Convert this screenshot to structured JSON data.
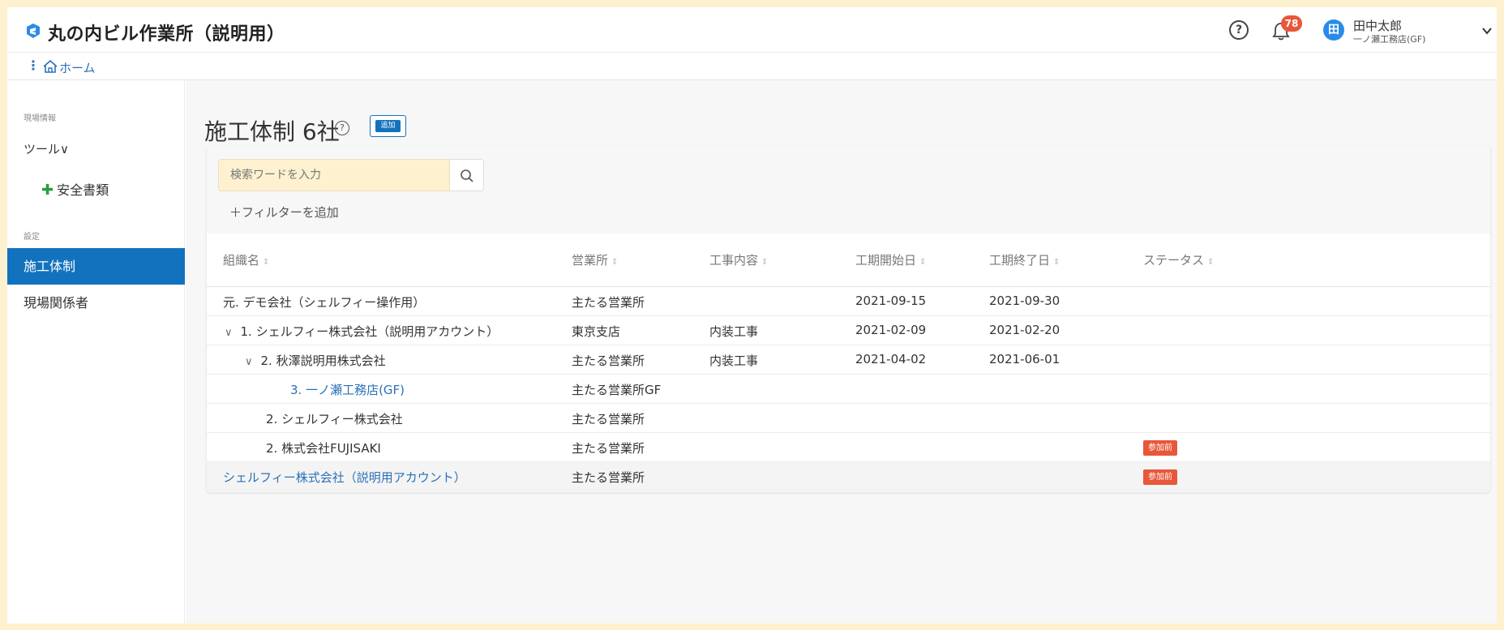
{
  "header": {
    "site_title": "丸の内ビル作業所（説明用）",
    "help_symbol": "?",
    "notification_count": "78",
    "user_avatar_initial": "田",
    "user_name": "田中太郎",
    "user_org": "一ノ瀬工務店(GF)"
  },
  "breadcrumb": {
    "menu_symbol": "⋮",
    "home_label": "ホーム"
  },
  "sidebar": {
    "section_site_info": "現場情報",
    "tool_label": "ツール∨",
    "safety_docs_label": "安全書類",
    "section_settings": "設定",
    "items": [
      {
        "label": "施工体制",
        "active": true
      },
      {
        "label": "現場関係者",
        "active": false
      }
    ]
  },
  "main": {
    "page_title": "施工体制 6社",
    "title_help_symbol": "?",
    "add_button_label": "追加",
    "search_placeholder": "検索ワードを入力",
    "add_filter_label": "＋フィルターを追加"
  },
  "table": {
    "headers": [
      "組織名",
      "営業所",
      "工事内容",
      "工期開始日",
      "工期終了日",
      "ステータス"
    ],
    "sort_symbol": "⇕",
    "rows": [
      {
        "org": "元. デモ会社（シェルフィー操作用）",
        "office": "主たる営業所",
        "work": "",
        "start": "2021-09-15",
        "end": "2021-09-30",
        "status": "",
        "chevron": ""
      },
      {
        "org": "1. シェルフィー株式会社（説明用アカウント）",
        "office": "東京支店",
        "work": "内装工事",
        "start": "2021-02-09",
        "end": "2021-02-20",
        "status": "",
        "chevron": "∨"
      },
      {
        "org": "2. 秋澤説明用株式会社",
        "office": "主たる営業所",
        "work": "内装工事",
        "start": "2021-04-02",
        "end": "2021-06-01",
        "status": "",
        "chevron": "∨"
      },
      {
        "org": "3. 一ノ瀬工務店(GF)",
        "office": "主たる営業所GF",
        "work": "",
        "start": "",
        "end": "",
        "status": "",
        "chevron": ""
      },
      {
        "org": "2. シェルフィー株式会社",
        "office": "主たる営業所",
        "work": "",
        "start": "",
        "end": "",
        "status": "",
        "chevron": ""
      },
      {
        "org": "2. 株式会社FUJISAKI",
        "office": "主たる営業所",
        "work": "",
        "start": "",
        "end": "",
        "status": "参加前",
        "chevron": ""
      },
      {
        "org": "シェルフィー株式会社（説明用アカウント）",
        "office": "主たる営業所",
        "work": "",
        "start": "",
        "end": "",
        "status": "参加前",
        "chevron": ""
      }
    ]
  },
  "colors": {
    "background_frame": "#fdf1cf",
    "primary_blue": "#1272bd",
    "link_blue": "#2a70b8",
    "badge_orange": "#e8573a",
    "plus_green": "#2a9d3c"
  }
}
